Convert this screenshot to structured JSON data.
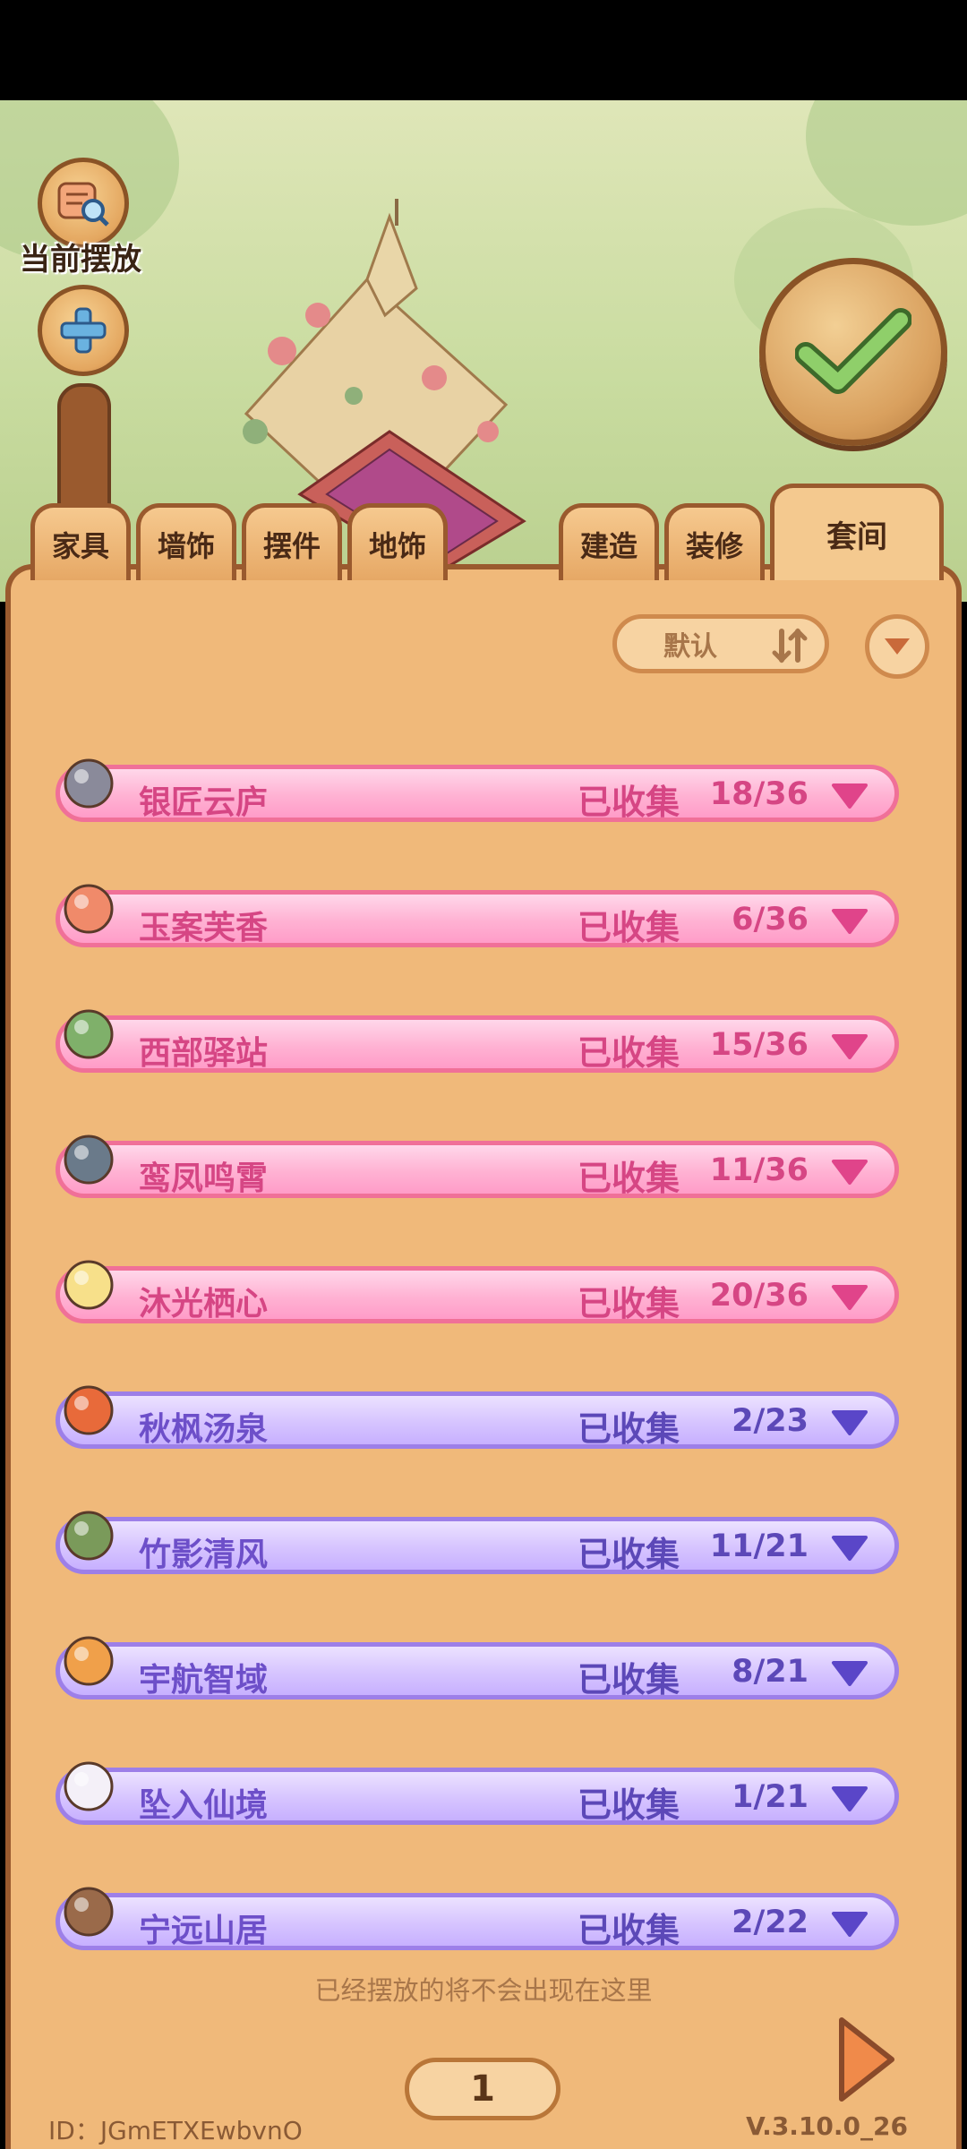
{
  "toolbar": {
    "current_label": "当前摆放"
  },
  "tabs": [
    {
      "label": "家具"
    },
    {
      "label": "墙饰"
    },
    {
      "label": "摆件"
    },
    {
      "label": "地饰"
    },
    {
      "label": "建造"
    },
    {
      "label": "装修"
    },
    {
      "label": "套间",
      "active": true
    }
  ],
  "sort": {
    "label": "默认"
  },
  "sets": [
    {
      "name": "银匠云庐",
      "status": "已收集",
      "count": "18/36",
      "style": "pink",
      "icon": "silver-lantern-icon"
    },
    {
      "name": "玉案芙香",
      "status": "已收集",
      "count": "6/36",
      "style": "pink",
      "icon": "rose-icon"
    },
    {
      "name": "西部驿站",
      "status": "已收集",
      "count": "15/36",
      "style": "pink",
      "icon": "cactus-icon"
    },
    {
      "name": "鸾凤鸣霄",
      "status": "已收集",
      "count": "11/36",
      "style": "pink",
      "icon": "pagoda-flower-icon"
    },
    {
      "name": "沐光栖心",
      "status": "已收集",
      "count": "20/36",
      "style": "pink",
      "icon": "white-flower-icon"
    },
    {
      "name": "秋枫汤泉",
      "status": "已收集",
      "count": "2/23",
      "style": "purple",
      "icon": "maple-leaf-icon"
    },
    {
      "name": "竹影清风",
      "status": "已收集",
      "count": "11/21",
      "style": "purple",
      "icon": "bamboo-icon"
    },
    {
      "name": "宇航智域",
      "status": "已收集",
      "count": "8/21",
      "style": "purple",
      "icon": "astronaut-icon"
    },
    {
      "name": "坠入仙境",
      "status": "已收集",
      "count": "1/21",
      "style": "purple",
      "icon": "white-rabbit-icon"
    },
    {
      "name": "宁远山居",
      "status": "已收集",
      "count": "2/22",
      "style": "purple",
      "icon": "tree-house-icon"
    }
  ],
  "hint": "已经摆放的将不会出现在这里",
  "pagination": {
    "page": "1"
  },
  "footer": {
    "id": "ID：JGmETXEwbvnO",
    "version": "V.3.10.0_26"
  },
  "colors": {
    "panel": "#f0b97a",
    "pink_row": "#ffb2d3",
    "purple_row": "#d6c4ff",
    "border_brown": "#9a5a2e"
  }
}
